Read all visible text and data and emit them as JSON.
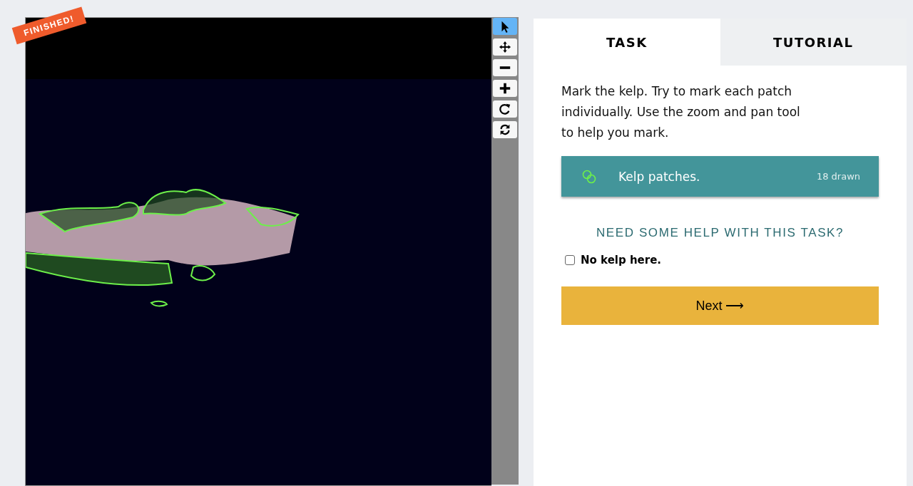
{
  "badge": "FINISHED!",
  "tools": [
    {
      "kind": "pointer",
      "selected": true
    },
    {
      "kind": "move",
      "selected": false
    },
    {
      "kind": "zoom-out",
      "selected": false
    },
    {
      "kind": "zoom-in",
      "selected": false
    },
    {
      "kind": "rotate",
      "selected": false
    },
    {
      "kind": "reset",
      "selected": false
    }
  ],
  "tabs": [
    {
      "label": "TASK",
      "selected": true
    },
    {
      "label": "TUTORIAL",
      "selected": false
    }
  ],
  "instructions": "Mark the kelp. Try to mark each patch individually. Use the zoom and pan tool to help you mark.",
  "tool_option": {
    "label": "Kelp patches.",
    "count": "18 drawn"
  },
  "help_link": "NEED SOME HELP WITH THIS TASK?",
  "checkbox": {
    "label": "No kelp here.",
    "checked": false
  },
  "next_button": "Next ⟶"
}
